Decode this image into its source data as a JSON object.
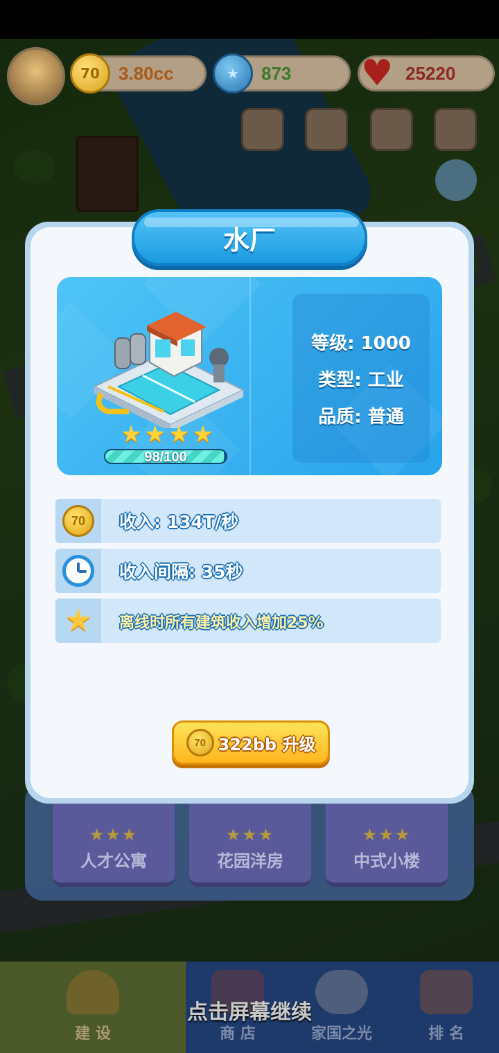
{
  "top_bar": {
    "coins": "3.80cc",
    "stars": "873",
    "hearts": "25220",
    "coin_icon_glyph": "70",
    "star_icon_glyph": "★",
    "heart_icon_glyph": "♥"
  },
  "panel": {
    "title": "水厂",
    "stats": {
      "level": "等级: 1000",
      "type": "类型: 工业",
      "quality": "品质: 普通"
    },
    "stars": [
      "★",
      "★",
      "★",
      "★"
    ],
    "progress_text": "98/100",
    "progress_fraction": 0.98,
    "rows": [
      {
        "icon": "coin-icon",
        "text": "收入: 134T/秒"
      },
      {
        "icon": "clock-icon",
        "text": "收入间隔: 35秒"
      },
      {
        "icon": "star-icon",
        "text": "离线时所有建筑收入增加25%"
      }
    ],
    "upgrade": {
      "coin_glyph": "70",
      "label": "322bb  升级"
    }
  },
  "background_cards": [
    {
      "stars": "★★★",
      "name": "人才公寓"
    },
    {
      "stars": "★★★",
      "name": "花园洋房"
    },
    {
      "stars": "★★★",
      "name": "中式小楼"
    }
  ],
  "bottom_nav": [
    {
      "label": "建 设"
    },
    {
      "label": "商 店"
    },
    {
      "label": "家国之光"
    },
    {
      "label": "排 名"
    }
  ],
  "continue_hint": "点击屏幕继续",
  "colors": {
    "accent_blue": "#1a9ae0",
    "button_gold": "#ffb61e",
    "star_yellow": "#ffd23a"
  }
}
